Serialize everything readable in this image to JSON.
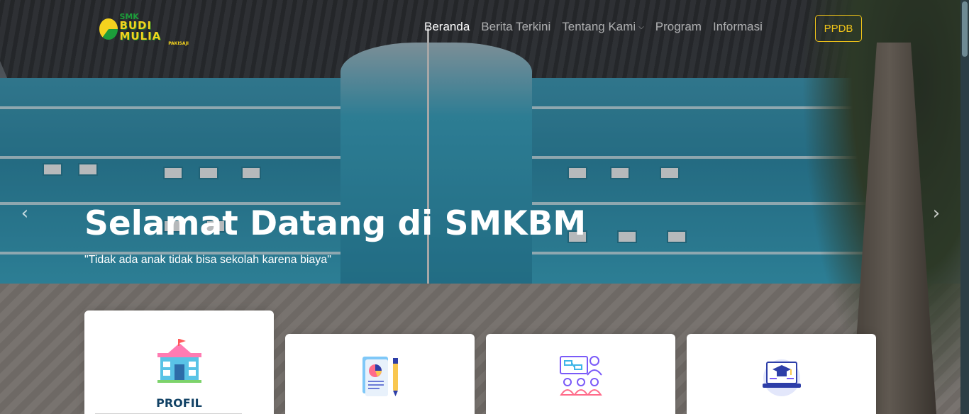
{
  "brand": {
    "logo_small": "SMK",
    "logo_big": "BUDI MULIA",
    "logo_sub": "PAKISAJI",
    "colors": {
      "green": "#1c9d3a",
      "yellow": "#f4d21e"
    }
  },
  "nav": {
    "items": [
      {
        "label": "Beranda",
        "active": true
      },
      {
        "label": "Berita Terkini",
        "active": false
      },
      {
        "label": "Tentang Kami",
        "active": false,
        "dropdown": true
      },
      {
        "label": "Program",
        "active": false
      },
      {
        "label": "Informasi",
        "active": false
      }
    ],
    "cta": "PPDB",
    "cta_color": "#f0c419"
  },
  "hero": {
    "title": "Selamat Datang di SMKBM",
    "quote": "\"Tidak ada anak tidak bisa sekolah karena biaya\"",
    "prev_icon": "chevron-left-icon",
    "next_icon": "chevron-right-icon"
  },
  "cards": [
    {
      "title": "PROFIL",
      "icon": "school-building-icon"
    },
    {
      "title": "",
      "icon": "report-document-icon"
    },
    {
      "title": "",
      "icon": "teacher-classroom-icon"
    },
    {
      "title": "",
      "icon": "online-graduation-icon"
    }
  ],
  "theme": {
    "title_color": "#124265"
  }
}
